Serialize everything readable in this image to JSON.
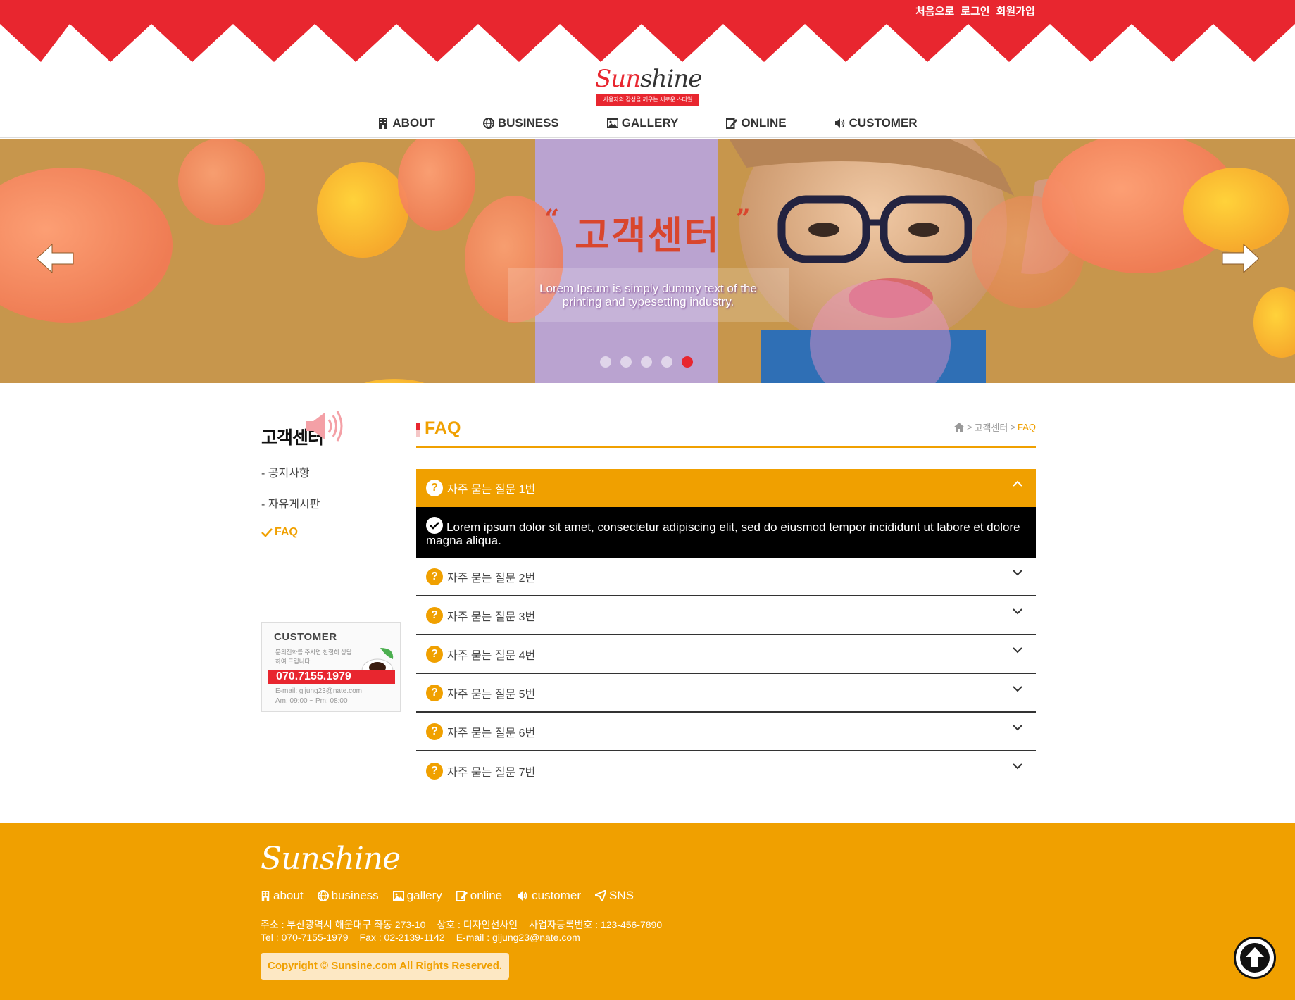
{
  "header": {
    "top_links": [
      "처음으로",
      "로그인",
      "회원가입"
    ],
    "logo": {
      "part1": "Sun",
      "part2": "shine",
      "tagline": "사용자의 감성을 깨우는 새로운 스타일"
    },
    "gnb": [
      {
        "label": "ABOUT",
        "icon": "building-icon"
      },
      {
        "label": "BUSINESS",
        "icon": "globe-icon"
      },
      {
        "label": "GALLERY",
        "icon": "image-icon"
      },
      {
        "label": "ONLINE",
        "icon": "edit-icon"
      },
      {
        "label": "CUSTOMER",
        "icon": "speaker-icon"
      }
    ]
  },
  "hero": {
    "open_quote": "“",
    "title": "고객센터",
    "close_quote": "”",
    "text": "Lorem Ipsum is simply dummy text of the printing and typesetting industry.",
    "slides": 5,
    "active_slide": 5
  },
  "side": {
    "title": "고객센터",
    "menu": [
      "- 공지사항",
      "- 자유게시판",
      "FAQ"
    ],
    "customer": {
      "title": "CUSTOMER",
      "sub": "문의전화를 주시면 친절히 상담하여 드립니다.",
      "phone": "070.7155.1979",
      "email": "E-mail: gijung23@nate.com",
      "hours": "Am: 09:00 ~ Pm: 08:00"
    }
  },
  "content": {
    "title": "FAQ",
    "breadcrumb": {
      "sep1": ">",
      "mid": "고객센터",
      "sep2": ">",
      "current": "FAQ"
    },
    "faq": [
      {
        "q": "자주 묻는 질문 1번",
        "open": true,
        "a": "Lorem ipsum dolor sit amet, consectetur adipiscing elit, sed do eiusmod tempor incididunt ut labore et dolore magna aliqua."
      },
      {
        "q": "자주 묻는 질문 2번"
      },
      {
        "q": "자주 묻는 질문 3번"
      },
      {
        "q": "자주 묻는 질문 4번"
      },
      {
        "q": "자주 묻는 질문 5번"
      },
      {
        "q": "자주 묻는 질문 6번"
      },
      {
        "q": "자주 묻는 질문 7번"
      }
    ]
  },
  "footer": {
    "logo": "Sunshine",
    "nav": [
      "about",
      "business",
      "gallery",
      "online",
      "customer",
      "SNS"
    ],
    "address": "주소 : 부산광역시 해운대구 좌동 273-10",
    "company": "상호 : 디자인선사인",
    "biz_no": "사업자등록번호 : 123-456-7890",
    "tel": "Tel : 070-7155-1979",
    "fax": "Fax : 02-2139-1142",
    "email": "E-mail : gijung23@nate.com",
    "copyright": "Copyright © Sunsine.com All Rights Reserved."
  },
  "colors": {
    "red": "#e8262f",
    "orange": "#f0a000",
    "black": "#000000"
  }
}
